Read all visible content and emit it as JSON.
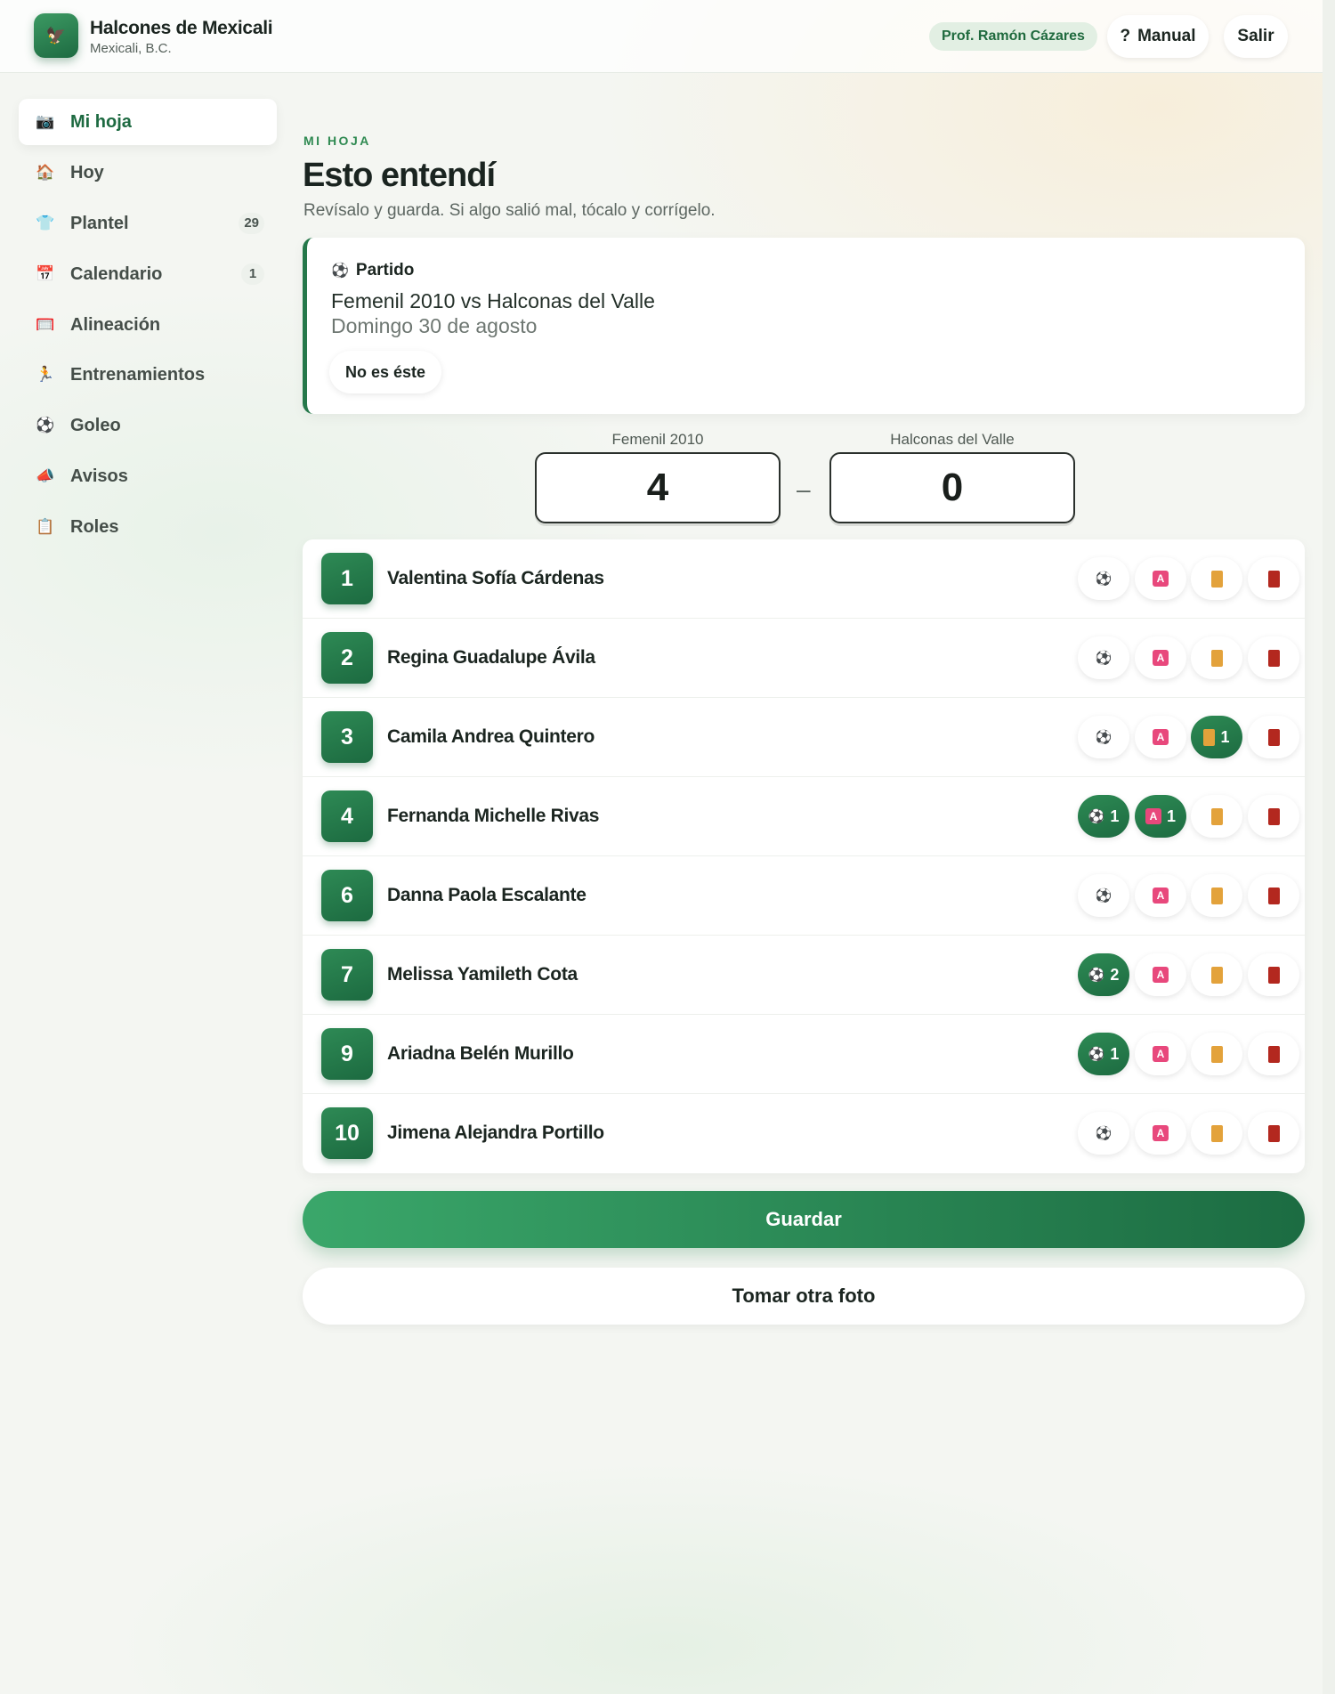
{
  "header": {
    "club_name": "Halcones de Mexicali",
    "club_city": "Mexicali, B.C.",
    "coach": "Prof. Ramón Cázares",
    "manual_label": "Manual",
    "manual_icon": "?",
    "logout_label": "Salir"
  },
  "sidebar": {
    "items": [
      {
        "label": "Mi hoja",
        "icon": "camera-icon",
        "glyph": "📷",
        "count": "",
        "active": true
      },
      {
        "label": "Hoy",
        "icon": "home-icon",
        "glyph": "🏠",
        "count": ""
      },
      {
        "label": "Plantel",
        "icon": "jersey-icon",
        "glyph": "👕",
        "count": "29"
      },
      {
        "label": "Calendario",
        "icon": "calendar-icon",
        "glyph": "📅",
        "count": "1"
      },
      {
        "label": "Alineación",
        "icon": "lineup-icon",
        "glyph": "🥅",
        "count": ""
      },
      {
        "label": "Entrenamientos",
        "icon": "runner-icon",
        "glyph": "🏃",
        "count": ""
      },
      {
        "label": "Goleo",
        "icon": "soccer-ball-icon",
        "glyph": "⚽",
        "count": ""
      },
      {
        "label": "Avisos",
        "icon": "megaphone-icon",
        "glyph": "📣",
        "count": ""
      },
      {
        "label": "Roles",
        "icon": "clipboard-icon",
        "glyph": "📋",
        "count": ""
      }
    ]
  },
  "main": {
    "eyebrow": "MI HOJA",
    "title": "Esto entendí",
    "subtitle": "Revísalo y guarda. Si algo salió mal, tócalo y corrígelo.",
    "match": {
      "tag": "Partido",
      "title": "Femenil 2010 vs Halconas del Valle",
      "date": "Domingo 30 de agosto",
      "wrong_button": "No es éste"
    },
    "score": {
      "home_team": "Femenil 2010",
      "home_score": "4",
      "away_team": "Halconas del Valle",
      "away_score": "0",
      "separator": "–"
    },
    "players": [
      {
        "number": "1",
        "name": "Valentina Sofía Cárdenas",
        "goals": 0,
        "assists": 0,
        "yellow": 0,
        "red": 0
      },
      {
        "number": "2",
        "name": "Regina Guadalupe Ávila",
        "goals": 0,
        "assists": 0,
        "yellow": 0,
        "red": 0
      },
      {
        "number": "3",
        "name": "Camila Andrea Quintero",
        "goals": 0,
        "assists": 0,
        "yellow": 1,
        "red": 0
      },
      {
        "number": "4",
        "name": "Fernanda Michelle Rivas",
        "goals": 1,
        "assists": 1,
        "yellow": 0,
        "red": 0
      },
      {
        "number": "6",
        "name": "Danna Paola Escalante",
        "goals": 0,
        "assists": 0,
        "yellow": 0,
        "red": 0
      },
      {
        "number": "7",
        "name": "Melissa Yamileth Cota",
        "goals": 2,
        "assists": 0,
        "yellow": 0,
        "red": 0
      },
      {
        "number": "9",
        "name": "Ariadna Belén Murillo",
        "goals": 1,
        "assists": 0,
        "yellow": 0,
        "red": 0
      },
      {
        "number": "10",
        "name": "Jimena Alejandra Portillo",
        "goals": 0,
        "assists": 0,
        "yellow": 0,
        "red": 0
      }
    ],
    "save_label": "Guardar",
    "retake_label": "Tomar otra foto"
  },
  "colors": {
    "brand": "#1d6a41",
    "accent": "#2f8a52",
    "yellow_card": "#e3a23b",
    "red_card": "#b3281f",
    "assist": "#e8487c"
  }
}
